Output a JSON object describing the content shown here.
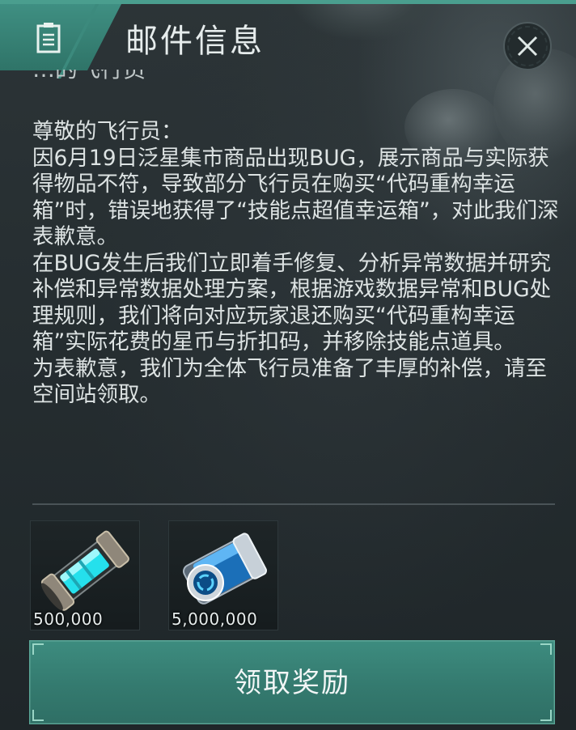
{
  "header": {
    "title": "邮件信息",
    "icon": "mail-document-icon",
    "close_icon": "close-icon"
  },
  "mail": {
    "partially_visible_line": "…的飞行员",
    "paragraphs": [
      "尊敬的飞行员：",
      "因6月19日泛星集市商品出现BUG，展示商品与实际获得物品不符，导致部分飞行员在购买“代码重构幸运箱”时，错误地获得了“技能点超值幸运箱”，对此我们深表歉意。",
      "在BUG发生后我们立即着手修复、分析异常数据并研究补偿和异常数据处理方案，根据游戏数据异常和BUG处理规则，我们将向对应玩家退还购买“代码重构幸运箱”实际花费的星币与折扣码，并移除技能点道具。",
      "为表歉意，我们为全体飞行员准备了丰厚的补偿，请至空间站领取。"
    ]
  },
  "rewards": [
    {
      "icon": "energy-capsule-icon",
      "quantity": "500,000"
    },
    {
      "icon": "blue-canister-icon",
      "quantity": "5,000,000"
    }
  ],
  "claim_button": {
    "label": "领取奖励"
  },
  "colors": {
    "accent": "#3d8c7f",
    "top_edge": "#4a9e8e",
    "text": "#dde3e3",
    "background": "#262e31"
  }
}
